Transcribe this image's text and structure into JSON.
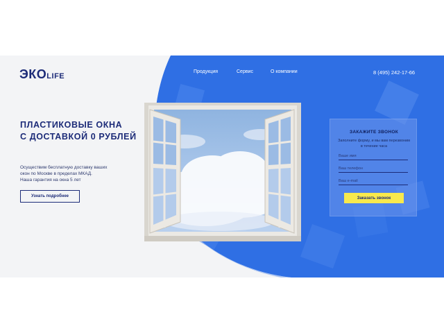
{
  "logo": {
    "main": "ЭКО",
    "suffix": "LIFE"
  },
  "nav": {
    "items": [
      "Продукция",
      "Сервис",
      "О компании"
    ]
  },
  "header": {
    "phone": "8 (495) 242-17-66"
  },
  "hero": {
    "headline": [
      "ПЛАСТИКОВЫЕ ОКНА",
      "С ДОСТАВКОЙ 0 РУБЛЕЙ"
    ],
    "description": [
      "Осуществим бесплатную доставку ваших",
      "окон по Москве в пределах МКАД.",
      "Наша гарантия на окна 5 лет"
    ],
    "more_button": "Узнать подробнее"
  },
  "form": {
    "title": "ЗАКАЖИТЕ ЗВОНОК",
    "subtitle": "Заполните форму, и мы вам перезвоним в течение часа",
    "name_placeholder": "Ваше имя",
    "phone_placeholder": "Ваш телефон",
    "email_placeholder": "Ваш e-mail",
    "submit": "Заказать звонок"
  },
  "colors": {
    "accent": "#2f6fe4",
    "brand": "#1c2b78",
    "button": "#f8e94d"
  }
}
